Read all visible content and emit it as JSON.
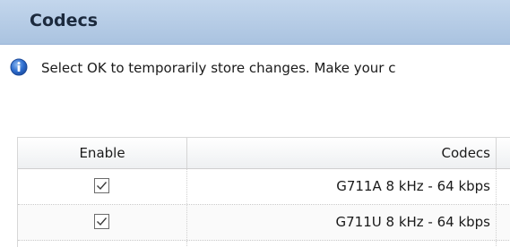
{
  "header": {
    "title": "Codecs"
  },
  "info": {
    "icon": "info-icon",
    "message": "Select OK to temporarily store changes. Make your c"
  },
  "table": {
    "columns": {
      "enable": "Enable",
      "codecs": "Codecs"
    },
    "rows": [
      {
        "enabled": true,
        "codec": "G711A 8 kHz - 64 kbps"
      },
      {
        "enabled": true,
        "codec": "G711U 8 kHz - 64 kbps"
      }
    ]
  },
  "colors": {
    "header_bg": "#b5cbe6",
    "info_icon": "#2d6bc7"
  }
}
